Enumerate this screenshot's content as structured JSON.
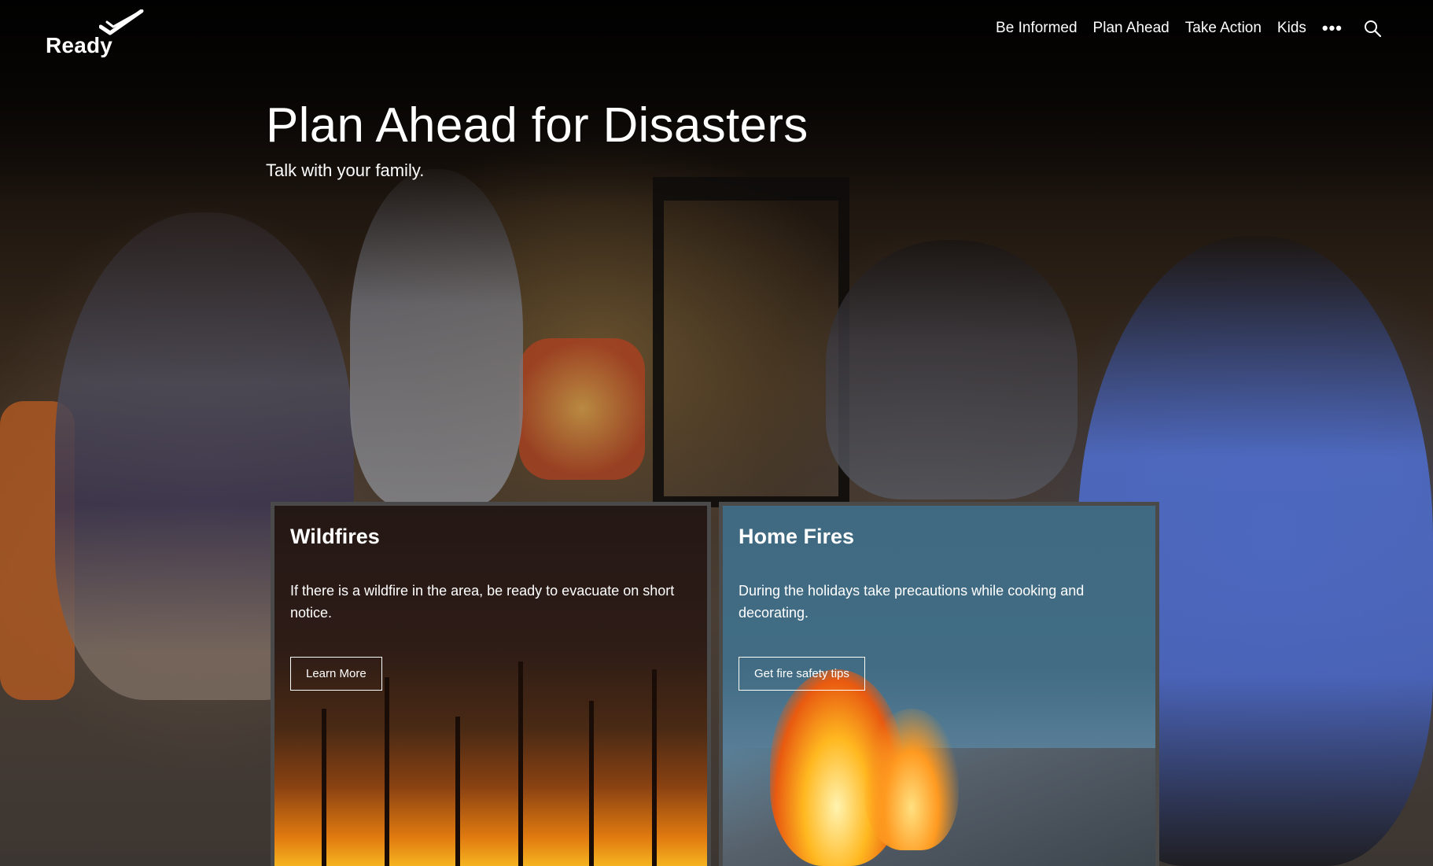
{
  "header": {
    "logo_text": "Ready",
    "nav": {
      "items": [
        {
          "label": "Be Informed"
        },
        {
          "label": "Plan Ahead"
        },
        {
          "label": "Take Action"
        },
        {
          "label": "Kids"
        }
      ],
      "more_glyph": "•••"
    }
  },
  "hero": {
    "title": "Plan Ahead for Disasters",
    "subtitle": "Talk with your family."
  },
  "cards": [
    {
      "title": "Wildfires",
      "text": "If there is a wildfire in the area, be ready to evacuate on short notice.",
      "button_label": "Learn More"
    },
    {
      "title": "Home Fires",
      "text": "During the holidays take precautions while cooking and decorating.",
      "button_label": "Get fire safety tips"
    }
  ],
  "icons": [
    "ready-checkmark-icon",
    "more-icon",
    "search-icon"
  ],
  "colors": {
    "home_fires_card": "#3f6a82",
    "card_border": "#4a4a4a",
    "text": "#ffffff"
  }
}
